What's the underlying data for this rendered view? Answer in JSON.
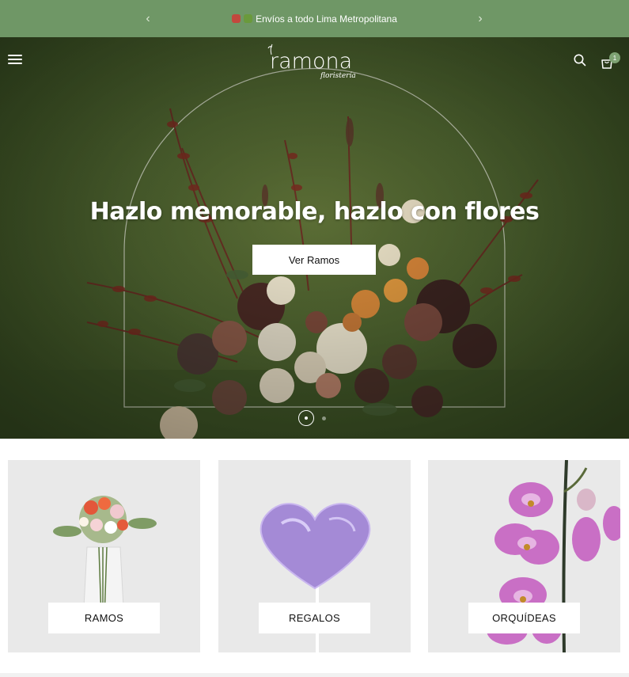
{
  "announcement": {
    "text": "Envíos a todo Lima Metropolitana",
    "prev_icon": "chevron-left-icon",
    "next_icon": "chevron-right-icon",
    "emoji_colors": [
      "#c2483d",
      "#6a9a3c"
    ]
  },
  "header": {
    "logo_text": "ramona",
    "logo_subtext": "floristería",
    "icons": [
      "menu-icon",
      "search-icon",
      "cart-icon"
    ],
    "cart_count": "1"
  },
  "hero": {
    "headline": "Hazlo memorable, hazlo con flores",
    "cta_label": "Ver Ramos",
    "slides": 2,
    "active_slide": 1
  },
  "categories": [
    {
      "label": "RAMOS"
    },
    {
      "label": "REGALOS"
    },
    {
      "label": "ORQUÍDEAS"
    }
  ],
  "colors": {
    "announcement_bg": "#6f9766",
    "hero_bg": "#4f6530",
    "card_bg": "#e9e9e9",
    "accent": "#7ea273"
  }
}
